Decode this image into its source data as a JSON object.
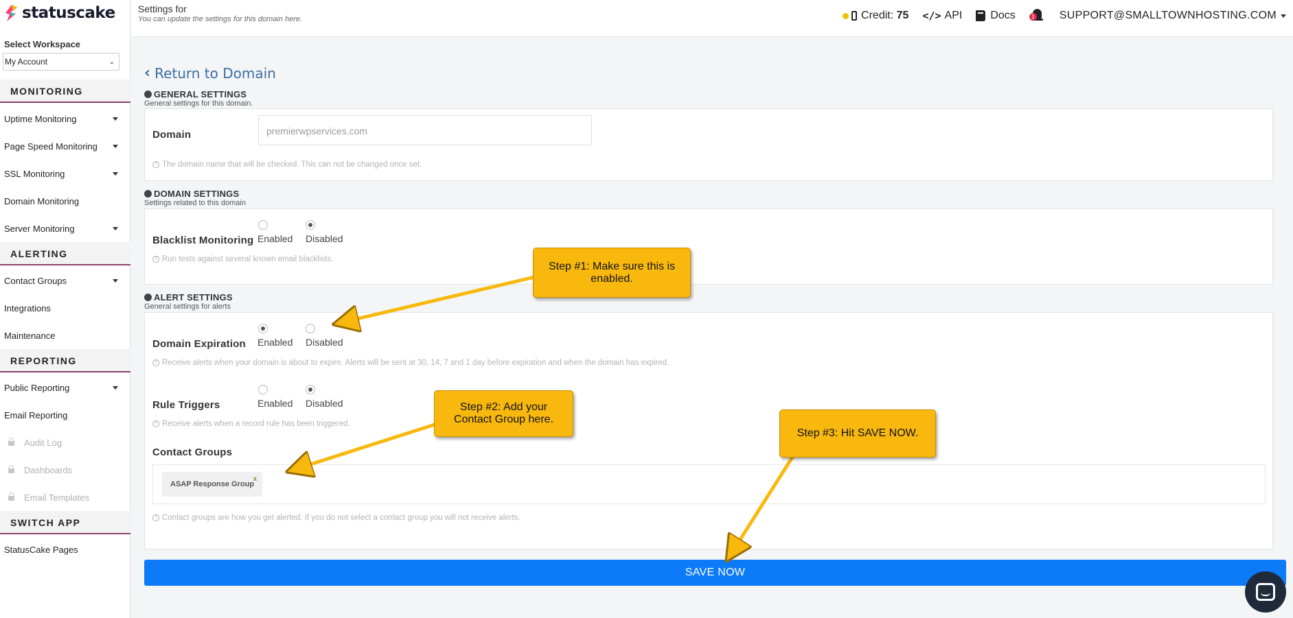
{
  "app": {
    "logo_text": "statuscake"
  },
  "sidebar": {
    "workspace_label": "Select Workspace",
    "workspace_value": "My Account",
    "sections": {
      "monitoring": "MONITORING",
      "alerting": "ALERTING",
      "reporting": "REPORTING",
      "switch_app": "SWITCH APP"
    },
    "items": {
      "uptime": "Uptime Monitoring",
      "pagespeed": "Page Speed Monitoring",
      "ssl": "SSL Monitoring",
      "domain": "Domain Monitoring",
      "server": "Server Monitoring",
      "contact_groups": "Contact Groups",
      "integrations": "Integrations",
      "maintenance": "Maintenance",
      "public_reporting": "Public Reporting",
      "email_reporting": "Email Reporting",
      "audit_log": "Audit Log",
      "dashboards": "Dashboards",
      "email_templates": "Email Templates",
      "statuscake_pages": "StatusCake Pages"
    }
  },
  "header": {
    "title": "Settings for",
    "subtitle": "You can update the settings for this domain here.",
    "credit_label": "Credit:",
    "credit_value": "75",
    "api_label": "API",
    "docs_label": "Docs",
    "notification_count": "1",
    "user": "SUPPORT@SMALLTOWNHOSTING.COM"
  },
  "main": {
    "return_link": "Return to Domain",
    "general": {
      "title": "GENERAL SETTINGS",
      "subtitle": "General settings for this domain.",
      "domain_label": "Domain",
      "domain_value": "premierwpservices.com",
      "domain_help": "The domain name that will be checked. This can not be changed once set."
    },
    "domain_settings": {
      "title": "DOMAIN SETTINGS",
      "subtitle": "Settings related to this domain",
      "blacklist_label": "Blacklist Monitoring",
      "enabled": "Enabled",
      "disabled": "Disabled",
      "blacklist_help": "Run tests against several known email blacklists."
    },
    "alert_settings": {
      "title": "ALERT SETTINGS",
      "subtitle": "General settings for alerts",
      "expiration_label": "Domain Expiration",
      "expiration_help": "Receive alerts when your domain is about to expire. Alerts will be sent at 30, 14, 7 and 1 day before expiration and when the domain has expired.",
      "rule_label": "Rule Triggers",
      "rule_help": "Receive alerts when a record rule has been triggered.",
      "contact_label": "Contact Groups",
      "contact_tag": "ASAP Response Group",
      "contact_tag_remove": "x",
      "contact_help": "Contact groups are how you get alerted. If you do not select a contact group you will not receive alerts.",
      "enabled": "Enabled",
      "disabled": "Disabled"
    },
    "save_label": "SAVE NOW"
  },
  "callouts": {
    "step1": "Step #1: Make sure this is enabled.",
    "step2": "Step #2: Add your Contact Group here.",
    "step3": "Step #3: Hit SAVE NOW."
  },
  "colors": {
    "accent": "#0d7af8",
    "callout": "#f8b80e",
    "section_border": "#8b3f6a"
  }
}
